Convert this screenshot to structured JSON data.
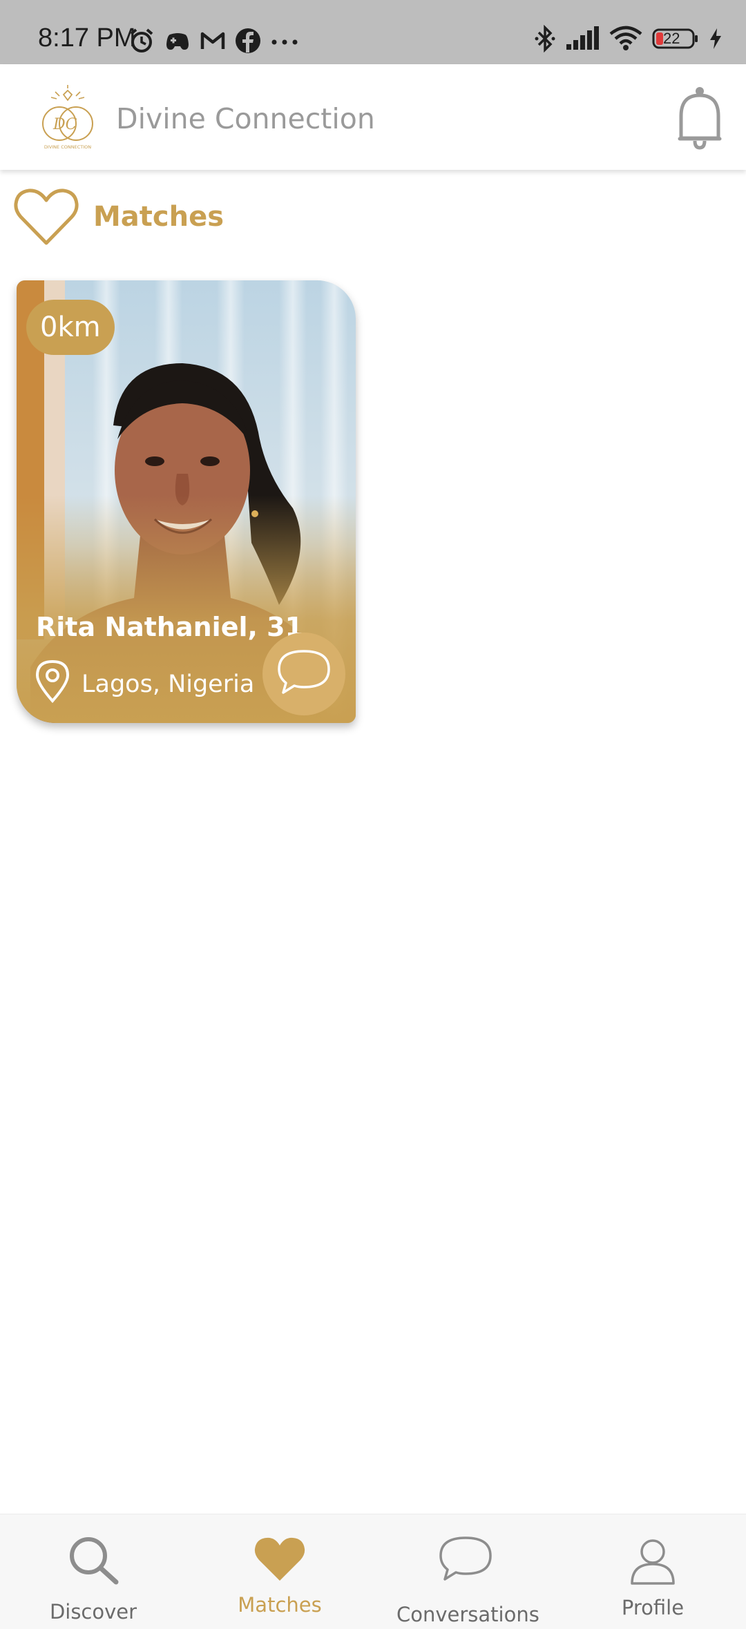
{
  "status_bar": {
    "time": "8:17 PM",
    "battery_level": "22",
    "icons_left": [
      "alarm-icon",
      "game-controller-icon",
      "gmail-icon",
      "facebook-icon",
      "more-icon"
    ],
    "icons_right": [
      "bluetooth-icon",
      "signal-icon",
      "wifi-icon",
      "battery-icon",
      "charging-icon"
    ]
  },
  "header": {
    "app_title": "Divine Connection",
    "logo_text": "DIVINE CONNECTION",
    "logo_initials": "DC",
    "notification_icon": "bell-icon"
  },
  "section": {
    "title": "Matches",
    "icon": "heart-outline-icon"
  },
  "matches": [
    {
      "distance": "0km",
      "name_age": "Rita Nathaniel, 31",
      "location": "Lagos, Nigeria",
      "location_icon": "location-pin-icon",
      "chat_icon": "chat-bubble-icon"
    }
  ],
  "bottom_nav": {
    "items": [
      {
        "label": "Discover",
        "icon": "search-icon",
        "active": false
      },
      {
        "label": "Matches",
        "icon": "heart-icon",
        "active": true
      },
      {
        "label": "Conversations",
        "icon": "chat-bubble-icon",
        "active": false
      },
      {
        "label": "Profile",
        "icon": "person-icon",
        "active": false
      }
    ]
  },
  "colors": {
    "accent": "#c9a052",
    "status_bar": "#bdbdbd",
    "nav_background": "#f7f7f7",
    "muted_text": "#9a9a9a"
  }
}
